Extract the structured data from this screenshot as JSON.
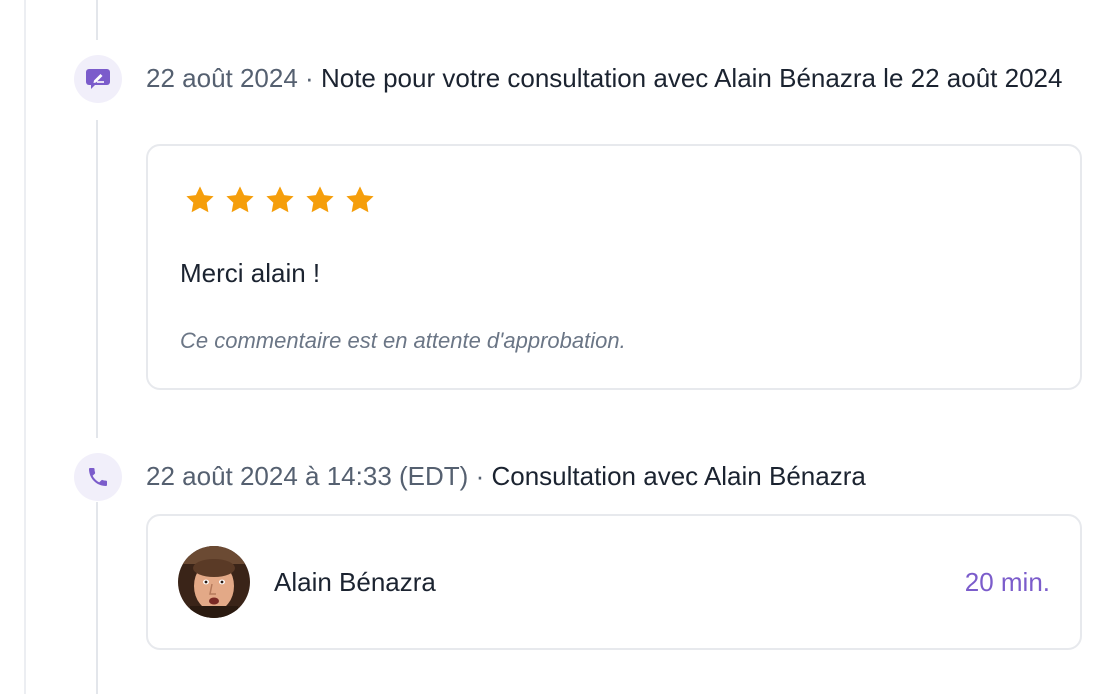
{
  "timeline": {
    "events": [
      {
        "icon": "note-edit-icon",
        "date": "22 août 2024",
        "separator": "·",
        "title": "Note pour votre consultation avec Alain Bénazra le 22 août 2024",
        "rating": 5,
        "rating_max": 5,
        "comment": "Merci alain !",
        "status": "Ce commentaire est en attente d'approbation."
      },
      {
        "icon": "phone-icon",
        "date": "22 août 2024 à 14:33 (EDT)",
        "separator": "·",
        "title": "Consultation avec Alain Bénazra",
        "advisor_name": "Alain Bénazra",
        "duration": "20 min."
      }
    ]
  },
  "colors": {
    "accent": "#7b5ccb",
    "star": "#f59e0b",
    "icon_bg": "#f1effa",
    "muted_text": "#556070",
    "status_text": "#6b7686",
    "border": "#e7e9ed"
  }
}
